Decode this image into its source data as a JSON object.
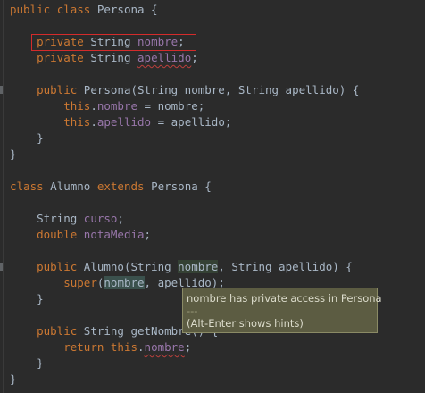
{
  "editor": {
    "lines": [
      [
        {
          "t": "public",
          "c": "kw"
        },
        {
          "t": " "
        },
        {
          "t": "class",
          "c": "kw"
        },
        {
          "t": " Persona {"
        }
      ],
      [],
      [
        {
          "t": "    "
        },
        {
          "t": "private",
          "c": "kw"
        },
        {
          "t": " String "
        },
        {
          "t": "nombre",
          "c": "fld"
        },
        {
          "t": ";"
        }
      ],
      [
        {
          "t": "    "
        },
        {
          "t": "private",
          "c": "kw"
        },
        {
          "t": " String "
        },
        {
          "t": "apellido",
          "c": "fld sq"
        },
        {
          "t": ";"
        }
      ],
      [],
      [
        {
          "t": "    "
        },
        {
          "t": "public",
          "c": "kw"
        },
        {
          "t": " Persona(String nombre, String apellido) {"
        }
      ],
      [
        {
          "t": "        "
        },
        {
          "t": "this",
          "c": "kw"
        },
        {
          "t": "."
        },
        {
          "t": "nombre",
          "c": "fld"
        },
        {
          "t": " = nombre;"
        }
      ],
      [
        {
          "t": "        "
        },
        {
          "t": "this",
          "c": "kw"
        },
        {
          "t": "."
        },
        {
          "t": "apellido",
          "c": "fld"
        },
        {
          "t": " = apellido;"
        }
      ],
      [
        {
          "t": "    }"
        }
      ],
      [
        {
          "t": "}"
        }
      ],
      [],
      [
        {
          "t": "class",
          "c": "kw"
        },
        {
          "t": " Alumno "
        },
        {
          "t": "extends",
          "c": "kw"
        },
        {
          "t": " Persona {"
        }
      ],
      [],
      [
        {
          "t": "    String "
        },
        {
          "t": "curso",
          "c": "fld"
        },
        {
          "t": ";"
        }
      ],
      [
        {
          "t": "    "
        },
        {
          "t": "double",
          "c": "kw"
        },
        {
          "t": " "
        },
        {
          "t": "notaMedia",
          "c": "fld"
        },
        {
          "t": ";"
        }
      ],
      [],
      [
        {
          "t": "    "
        },
        {
          "t": "public",
          "c": "kw"
        },
        {
          "t": " Alumno(String "
        },
        {
          "t": "nombre",
          "c": "hl-word"
        },
        {
          "t": ", String apellido) {"
        }
      ],
      [
        {
          "t": "        "
        },
        {
          "t": "super",
          "c": "kw"
        },
        {
          "t": "("
        },
        {
          "t": "nombre",
          "c": "hl-usage"
        },
        {
          "t": ", apellido);"
        }
      ],
      [
        {
          "t": "    }"
        }
      ],
      [],
      [
        {
          "t": "    "
        },
        {
          "t": "public",
          "c": "kw"
        },
        {
          "t": " String getNombre() {"
        }
      ],
      [
        {
          "t": "        "
        },
        {
          "t": "return",
          "c": "kw"
        },
        {
          "t": " "
        },
        {
          "t": "this",
          "c": "kw"
        },
        {
          "t": "."
        },
        {
          "t": "nombre",
          "c": "fld sq"
        },
        {
          "t": ";"
        }
      ],
      [
        {
          "t": "    }"
        }
      ],
      [
        {
          "t": "}"
        }
      ]
    ]
  },
  "tooltip": {
    "message": "nombre has private access in Persona",
    "separator": "---",
    "hint": "(Alt-Enter shows hints)"
  }
}
